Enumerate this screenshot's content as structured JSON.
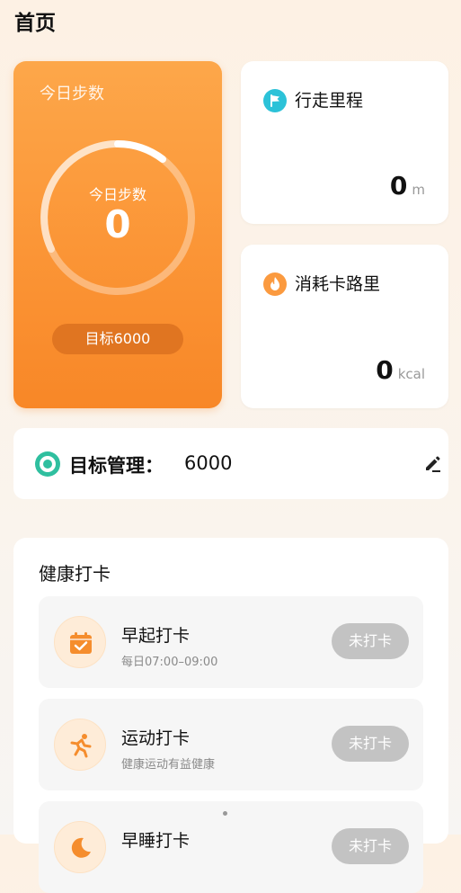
{
  "page": {
    "title": "首页"
  },
  "steps_card": {
    "title": "今日步数",
    "ring_label": "今日步数",
    "steps": "0",
    "goal_label": "目标6000",
    "progress": 0
  },
  "distance_card": {
    "title": "行走里程",
    "value": "0",
    "unit": "m",
    "icon": "flag-icon",
    "icon_color": "#2cc2d8"
  },
  "calorie_card": {
    "title": "消耗卡路里",
    "value": "0",
    "unit": "kcal",
    "icon": "flame-icon",
    "icon_color": "#fb9a3f"
  },
  "goal_management": {
    "label": "目标管理：",
    "value": "6000",
    "icon": "target-icon",
    "accent": "#2fbf9f"
  },
  "health": {
    "title": "健康打卡",
    "items": [
      {
        "name": "早起打卡",
        "sub": "每日07:00–09:00",
        "button": "未打卡",
        "icon": "calendar-check-icon"
      },
      {
        "name": "运动打卡",
        "sub": "健康运动有益健康",
        "button": "未打卡",
        "icon": "running-icon"
      },
      {
        "name": "早睡打卡",
        "sub": "",
        "button": "未打卡",
        "icon": "moon-icon"
      }
    ]
  },
  "colors": {
    "orange": "#fb9536",
    "button_gray": "#c3c3c3"
  }
}
